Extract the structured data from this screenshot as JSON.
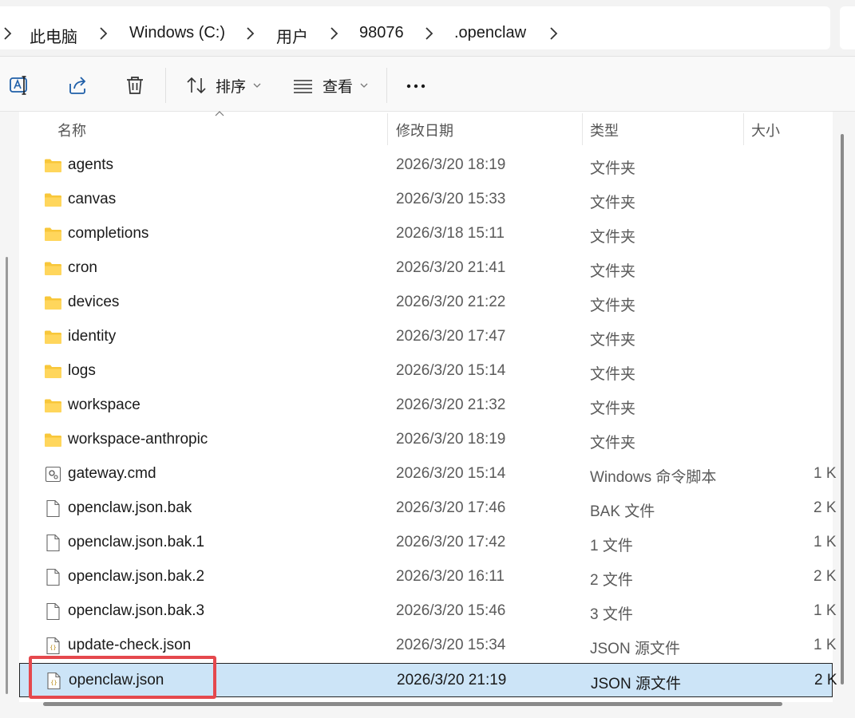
{
  "breadcrumb": [
    "此电脑",
    "Windows (C:)",
    "用户",
    "98076",
    ".openclaw"
  ],
  "toolbar": {
    "sort_label": "排序",
    "view_label": "查看",
    "more_label": "..."
  },
  "headers": {
    "name": "名称",
    "date": "修改日期",
    "type": "类型",
    "size": "大小"
  },
  "files": [
    {
      "name": "agents",
      "date": "2026/3/20 18:19",
      "type": "文件夹",
      "size": "",
      "icon": "folder-icon"
    },
    {
      "name": "canvas",
      "date": "2026/3/20 15:33",
      "type": "文件夹",
      "size": "",
      "icon": "folder-icon"
    },
    {
      "name": "completions",
      "date": "2026/3/18 15:11",
      "type": "文件夹",
      "size": "",
      "icon": "folder-icon"
    },
    {
      "name": "cron",
      "date": "2026/3/20 21:41",
      "type": "文件夹",
      "size": "",
      "icon": "folder-icon"
    },
    {
      "name": "devices",
      "date": "2026/3/20 21:22",
      "type": "文件夹",
      "size": "",
      "icon": "folder-icon"
    },
    {
      "name": "identity",
      "date": "2026/3/20 17:47",
      "type": "文件夹",
      "size": "",
      "icon": "folder-icon"
    },
    {
      "name": "logs",
      "date": "2026/3/20 15:14",
      "type": "文件夹",
      "size": "",
      "icon": "folder-icon"
    },
    {
      "name": "workspace",
      "date": "2026/3/20 21:32",
      "type": "文件夹",
      "size": "",
      "icon": "folder-icon"
    },
    {
      "name": "workspace-anthropic",
      "date": "2026/3/20 18:19",
      "type": "文件夹",
      "size": "",
      "icon": "folder-icon"
    },
    {
      "name": "gateway.cmd",
      "date": "2026/3/20 15:14",
      "type": "Windows 命令脚本",
      "size": "1 K",
      "icon": "cmd-file-icon"
    },
    {
      "name": "openclaw.json.bak",
      "date": "2026/3/20 17:46",
      "type": "BAK 文件",
      "size": "2 K",
      "icon": "file-icon"
    },
    {
      "name": "openclaw.json.bak.1",
      "date": "2026/3/20 17:42",
      "type": "1 文件",
      "size": "1 K",
      "icon": "file-icon"
    },
    {
      "name": "openclaw.json.bak.2",
      "date": "2026/3/20 16:11",
      "type": "2 文件",
      "size": "2 K",
      "icon": "file-icon"
    },
    {
      "name": "openclaw.json.bak.3",
      "date": "2026/3/20 15:46",
      "type": "3 文件",
      "size": "1 K",
      "icon": "file-icon"
    },
    {
      "name": "update-check.json",
      "date": "2026/3/20 15:34",
      "type": "JSON 源文件",
      "size": "1 K",
      "icon": "json-file-icon"
    },
    {
      "name": "openclaw.json",
      "date": "2026/3/20 21:19",
      "type": "JSON 源文件",
      "size": "2 K",
      "icon": "json-file-icon",
      "selected": true
    }
  ],
  "colors": {
    "selection": "#cce4f7",
    "highlight_box": "#e5484d",
    "folder": "#f8c73a"
  }
}
